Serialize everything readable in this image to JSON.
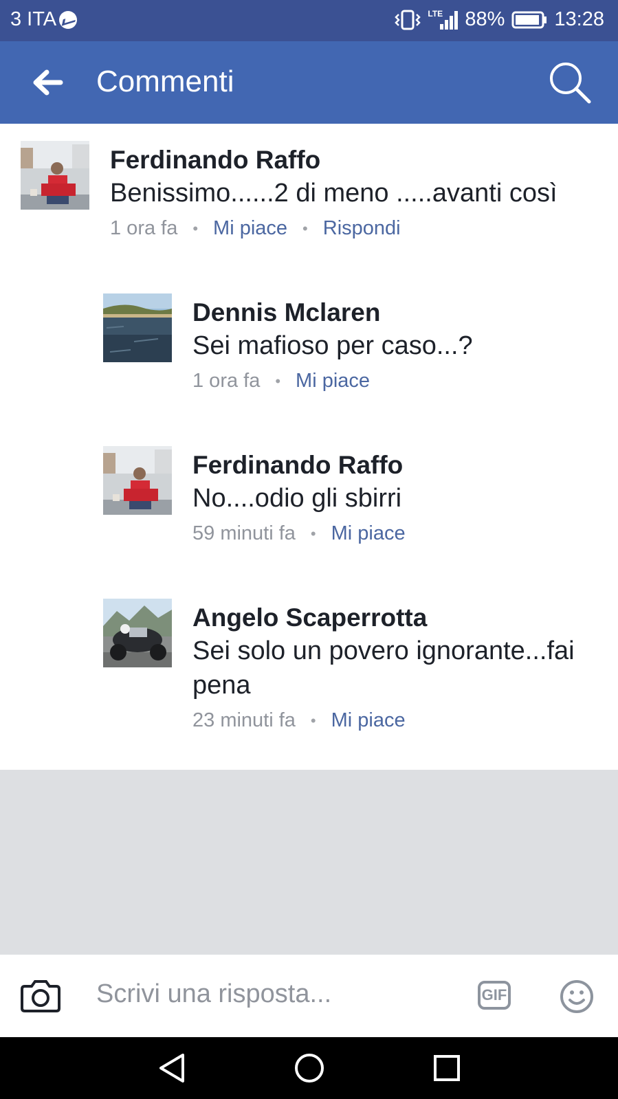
{
  "status_bar": {
    "carrier": "3 ITA",
    "network": "LTE",
    "battery": "88%",
    "time": "13:28"
  },
  "header": {
    "title": "Commenti"
  },
  "comments": [
    {
      "author": "Ferdinando Raffo",
      "text": "Benissimo......2 di meno .....avanti così",
      "time": "1 ora fa",
      "like": "Mi piace",
      "reply": "Rispondi"
    },
    {
      "author": "Dennis Mclaren",
      "text": "Sei mafioso per caso...?",
      "time": "1 ora fa",
      "like": "Mi piace"
    },
    {
      "author": "Ferdinando Raffo",
      "text": "No....odio gli sbirri",
      "time": "59 minuti fa",
      "like": "Mi piace"
    },
    {
      "author": "Angelo Scaperrotta",
      "text_line1": "Sei solo un povero ignorante...fai",
      "text_line2": "pena",
      "time": "23 minuti fa",
      "like": "Mi piace"
    }
  ],
  "composer": {
    "placeholder": "Scrivi una risposta...",
    "gif_label": "GIF"
  },
  "icons": [
    "messenger-icon",
    "vibrate-icon",
    "signal-icon",
    "battery-icon",
    "back-arrow-icon",
    "search-icon",
    "camera-icon",
    "gif-icon",
    "emoji-icon",
    "nav-back-icon",
    "nav-home-icon",
    "nav-recents-icon"
  ],
  "colors": {
    "status_bar": "#3b5193",
    "app_bar": "#4267b2",
    "link": "#4b67a1",
    "meta": "#90949c",
    "gray_area": "#dddfe2"
  }
}
